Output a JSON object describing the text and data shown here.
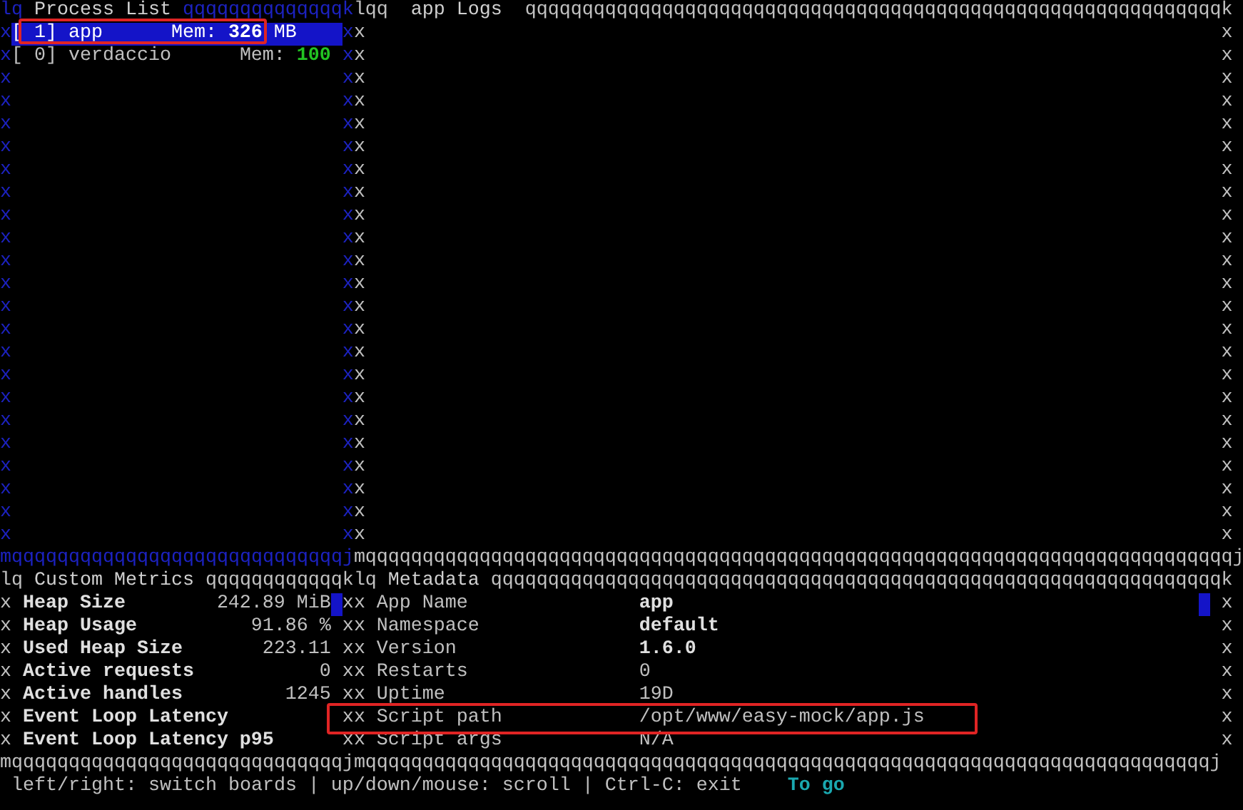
{
  "process_panel": {
    "focused": true,
    "corner": "lq",
    "title": "Process List",
    "rule": "qqqqqqqqqqqqqqk",
    "left_edge": "xxxxxxxxxxxxxxxxxxxxxxx",
    "right_edge": "xxxxxxxxxxxxxxxxxxxxxxx",
    "bottom_rule": "mqqqqqqqqqqqqqqqqqqqqqqqqqqqqqj",
    "processes": [
      {
        "id": "[ 1]",
        "name": "app",
        "mem_label": "Mem:",
        "mem": "326",
        "unit": "MB",
        "selected": true
      },
      {
        "id": "[ 0]",
        "name": "verdaccio",
        "mem_label": "Mem:",
        "mem": "100",
        "selected": false
      }
    ]
  },
  "logs_panel": {
    "focused": false,
    "corner": "lqq",
    "title": "app Logs",
    "rule": "qqqqqqqqqqqqqqqqqqqqqqqqqqqqqqqqqqqqqqqqqqqqqqqqqqqqqqqqqqqqqk",
    "left_edge": "xxxxxxxxxxxxxxxxxxxxxxx",
    "right_edge": "xxxxxxxxxxxxxxxxxxxxxxx",
    "bottom_rule": "mqqqqqqqqqqqqqqqqqqqqqqqqqqqqqqqqqqqqqqqqqqqqqqqqqqqqqqqqqqqqqqqqqqqqqqqqqqqqj"
  },
  "metrics_panel": {
    "focused": false,
    "corner": "lq",
    "title": "Custom Metrics",
    "rule": "qqqqqqqqqqqqk",
    "left_edge": "xxxxxxx",
    "right_edge": "xxxxxxx",
    "bottom_rule": "mqqqqqqqqqqqqqqqqqqqqqqqqqqqqqj",
    "rows": [
      {
        "label": "Heap Size",
        "value": "242.89 MiB"
      },
      {
        "label": "Heap Usage",
        "value": "91.86 %"
      },
      {
        "label": "Used Heap Size",
        "value": "223.11"
      },
      {
        "label": "Active requests",
        "value": "0"
      },
      {
        "label": "Active handles",
        "value": "1245"
      },
      {
        "label": "Event Loop Latency"
      },
      {
        "label": "Event Loop Latency p95"
      }
    ]
  },
  "metadata_panel": {
    "focused": false,
    "corner": "lq",
    "title": "Metadata",
    "rule": "qqqqqqqqqqqqqqqqqqqqqqqqqqqqqqqqqqqqqqqqqqqqqqqqqqqqqqqqqqqqqqqqk",
    "left_edge": "xxxxxxx",
    "right_edge": "xxxxxxx",
    "bottom_rule": "mqqqqqqqqqqqqqqqqqqqqqqqqqqqqqqqqqqqqqqqqqqqqqqqqqqqqqqqqqqqqqqqqqqqqqqqqqqj",
    "rows": [
      {
        "label": "App Name",
        "value": "app",
        "bold": true
      },
      {
        "label": "Namespace",
        "value": "default",
        "bold": true
      },
      {
        "label": "Version",
        "value": "1.6.0",
        "bold": true
      },
      {
        "label": "Restarts",
        "value": "0",
        "bold": false
      },
      {
        "label": "Uptime",
        "value": "19D",
        "bold": false
      },
      {
        "label": "Script path",
        "value": "/opt/www/easy-mock/app.js",
        "bold": false
      },
      {
        "label": "Script args",
        "value": "N/A",
        "bold": false
      }
    ]
  },
  "help_bar": {
    "keys": "left/right: switch boards | up/down/mouse: scroll | Ctrl-C: exit",
    "hint": "To go"
  }
}
